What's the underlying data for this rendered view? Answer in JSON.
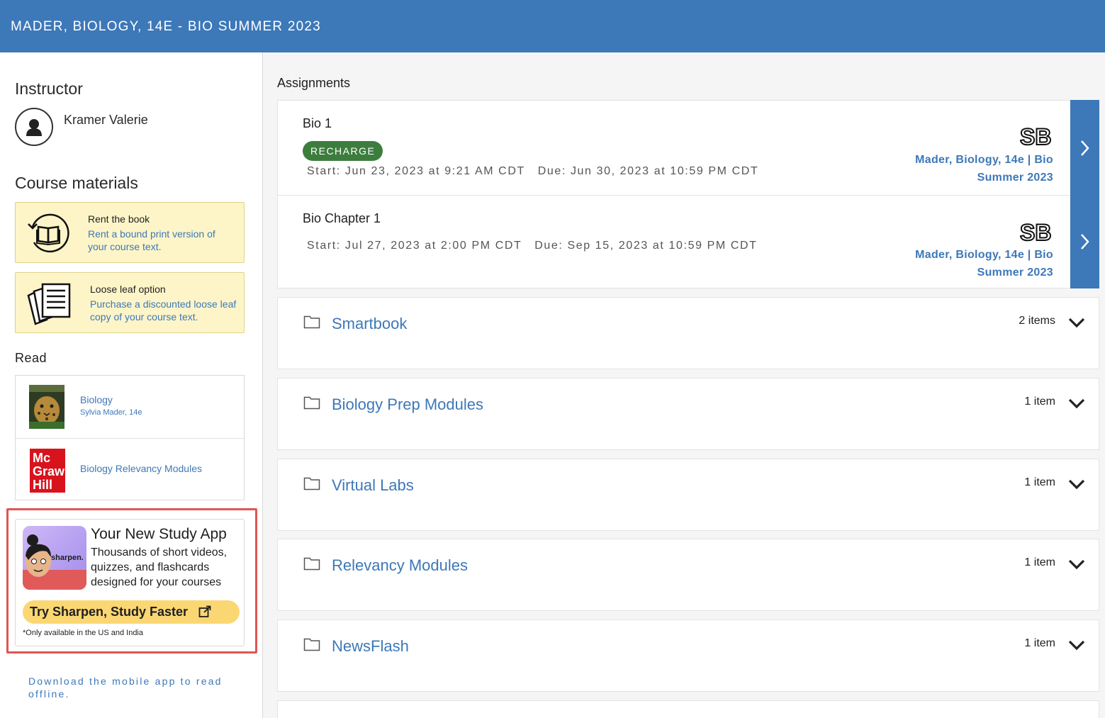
{
  "header": {
    "course_title": "MADER, BIOLOGY, 14E - BIO SUMMER 2023"
  },
  "sidebar": {
    "instructor_heading": "Instructor",
    "instructor_name": "Kramer Valerie",
    "materials_heading": "Course materials",
    "materials": [
      {
        "title": "Rent the book",
        "description": "Rent a bound print version of your course text.",
        "icon": "book-rental-icon"
      },
      {
        "title": "Loose leaf option",
        "description": "Purchase a discounted loose leaf copy of your course text.",
        "icon": "loose-leaf-pages-icon"
      }
    ],
    "read_heading": "Read",
    "read_items": [
      {
        "title": "Biology",
        "subtitle": "Sylvia Mader, 14e",
        "cover": "biology-book-cover"
      },
      {
        "title": "Biology Relevancy Modules",
        "cover": "mcgraw-hill-logo",
        "logo_text": [
          "Mc",
          "Graw",
          "Hill"
        ]
      }
    ],
    "promo": {
      "title": "Your New Study App",
      "description": "Thousands of short videos, quizzes, and flashcards designed for your courses",
      "image_text": "sharpen.",
      "button_label": "Try Sharpen, Study Faster",
      "note": "*Only available in the US and India"
    },
    "download_text": "Download the mobile app to read offline."
  },
  "main": {
    "assignments_heading": "Assignments",
    "assignments": [
      {
        "title": "Bio 1",
        "badge": "RECHARGE",
        "dates": "Start: Jun 23, 2023 at 9:21 AM CDT   Due: Jun 30, 2023 at 10:59 PM CDT",
        "course_line1": "Mader, Biology, 14e | Bio",
        "course_line2": "Summer 2023",
        "logo": "SB"
      },
      {
        "title": "Bio Chapter 1",
        "dates": "Start: Jul 27, 2023 at 2:00 PM CDT   Due: Sep 15, 2023 at 10:59 PM CDT",
        "course_line1": "Mader, Biology, 14e | Bio",
        "course_line2": "Summer 2023",
        "logo": "SB"
      }
    ],
    "folders": [
      {
        "name": "Smartbook",
        "count": "2 items"
      },
      {
        "name": "Biology Prep Modules",
        "count": "1 item"
      },
      {
        "name": "Virtual Labs",
        "count": "1 item"
      },
      {
        "name": "Relevancy Modules",
        "count": "1 item"
      },
      {
        "name": "NewsFlash",
        "count": "1 item"
      }
    ]
  },
  "colors": {
    "brand_blue": "#3d78b8",
    "recharge_green": "#3c7d3e",
    "promo_yellow": "#fbd773",
    "highlight_red": "#e05553",
    "materials_bg": "#fdf5c8"
  }
}
